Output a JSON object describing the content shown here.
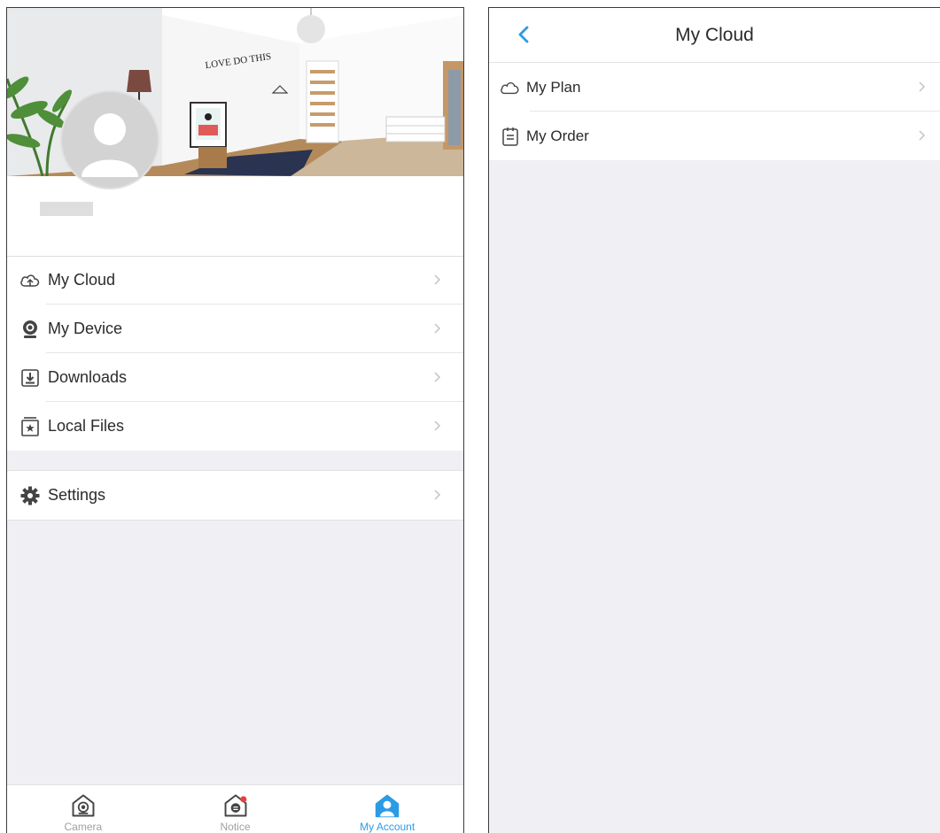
{
  "left_screen": {
    "header": {
      "art_text": "LOVE DO THIS"
    },
    "menu_group_1": [
      {
        "label": "My Cloud",
        "icon": "cloud-upload-icon"
      },
      {
        "label": "My Device",
        "icon": "webcam-icon"
      },
      {
        "label": "Downloads",
        "icon": "download-icon"
      },
      {
        "label": "Local Files",
        "icon": "star-folder-icon"
      }
    ],
    "menu_group_2": [
      {
        "label": "Settings",
        "icon": "gear-icon"
      }
    ],
    "tabbar": {
      "tabs": [
        {
          "label": "Camera",
          "icon": "camera-home-icon",
          "active": false
        },
        {
          "label": "Notice",
          "icon": "notice-home-icon",
          "active": false
        },
        {
          "label": "My Account",
          "icon": "account-home-icon",
          "active": true
        }
      ]
    }
  },
  "right_screen": {
    "title": "My Cloud",
    "back_icon": "chevron-left-icon",
    "items": [
      {
        "label": "My Plan",
        "icon": "cloud-icon"
      },
      {
        "label": "My Order",
        "icon": "clipboard-icon"
      }
    ]
  },
  "colors": {
    "accent": "#2c9be6",
    "background": "#efeff4",
    "separator": "#e6e6e6",
    "text": "#2b2b2b",
    "chevron": "#c4c4c4"
  }
}
